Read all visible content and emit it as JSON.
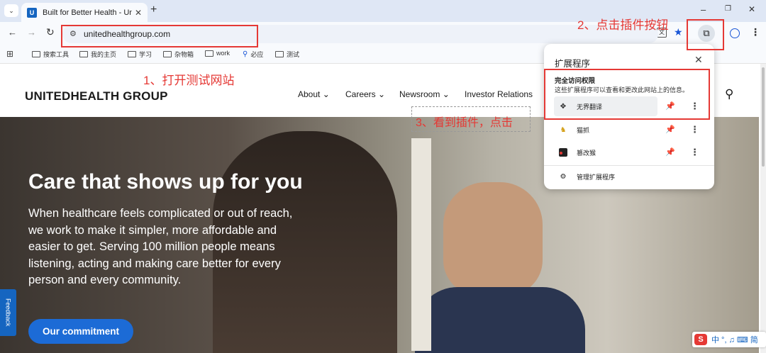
{
  "browser": {
    "tab_title": "Built for Better Health - Unite",
    "tab_icon_letter": "U",
    "url": "unitedhealthgroup.com",
    "new_tab": "+",
    "window_controls": [
      "–",
      "❐",
      "✕"
    ],
    "bookmarks": [
      {
        "label": "搜索工具",
        "icon": "folder-icon"
      },
      {
        "label": "我的主页",
        "icon": "folder-icon"
      },
      {
        "label": "学习",
        "icon": "folder-icon"
      },
      {
        "label": "杂物箱",
        "icon": "folder-icon"
      },
      {
        "label": "work",
        "icon": "folder-icon"
      },
      {
        "label": "必应",
        "icon": "search-icon"
      },
      {
        "label": "测试",
        "icon": "folder-icon"
      }
    ]
  },
  "site": {
    "logo": "UNITEDHEALTH GROUP",
    "nav": [
      "About",
      "Careers",
      "Newsroom",
      "Investor Relations"
    ],
    "hero_heading": "Care that shows up for you",
    "hero_text": "When healthcare feels complicated or out of reach, we work to make it simpler, more affordable and easier to get. Serving 100 million people means listening, acting and making care better for every person and every community.",
    "cta": "Our commitment",
    "feedback": "Feedback"
  },
  "extensions_popup": {
    "title": "扩展程序",
    "section_title": "完全访问权限",
    "section_desc": "这些扩展程序可以查看和更改此网站上的信息。",
    "items": [
      {
        "name": "无界翻译",
        "icon": "translate-icon"
      },
      {
        "name": "猫抓",
        "icon": "cat-catch-icon"
      },
      {
        "name": "篡改猴",
        "icon": "tampermonkey-icon"
      }
    ],
    "manage": "管理扩展程序"
  },
  "annotations": {
    "step1": "1、打开测试网站",
    "step2": "2、点击插件按钮",
    "step3": "3、看到插件，点击"
  },
  "ime": {
    "logo": "S",
    "status": "中 °, ♫ ⌨ 简"
  },
  "colors": {
    "annotation_red": "#e53935",
    "cta_blue": "#1c6bd6",
    "tabstrip": "#dfe7f5"
  }
}
